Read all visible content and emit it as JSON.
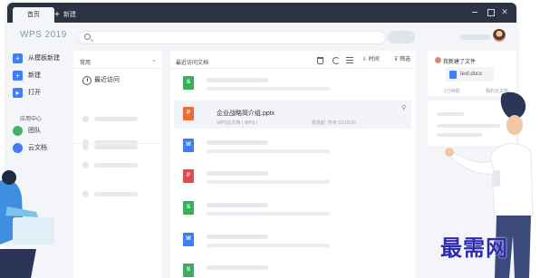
{
  "app": {
    "title": "WPS 2019"
  },
  "tabs": [
    {
      "label": "首页"
    },
    {
      "label": "新建"
    }
  ],
  "sidebar": {
    "items": [
      {
        "label": "从模板新建"
      },
      {
        "label": "新建"
      },
      {
        "label": "打开"
      },
      {
        "label": "团队"
      },
      {
        "label": "云文档"
      }
    ],
    "section": "应用中心"
  },
  "common": {
    "header": "常用",
    "recent": "最近访问"
  },
  "main": {
    "header": "最近访问文档",
    "sort_label": "时间",
    "filter_label": "筛选",
    "docs": [
      {
        "icon_letter": "S"
      },
      {
        "icon_letter": "P",
        "title": "企业战略简介组.pptx",
        "location": "WPS云文档 ( WPS )",
        "owner": "我发起",
        "time": "昨天 10:18:00"
      },
      {
        "icon_letter": "W"
      },
      {
        "icon_letter": "P"
      },
      {
        "icon_letter": "S"
      },
      {
        "icon_letter": "W"
      },
      {
        "icon_letter": "S"
      }
    ]
  },
  "notify": {
    "title": "我新建了文件",
    "file": "text.docx",
    "time": "2分钟前",
    "source": "我的云文档"
  },
  "colors": {
    "titlebar": "#2b3342",
    "accent": "#3f7ef7",
    "spreadsheet": "#3dad5b",
    "presentation": "#ec6a35",
    "pdf": "#e5484d"
  },
  "watermark": "最需网"
}
